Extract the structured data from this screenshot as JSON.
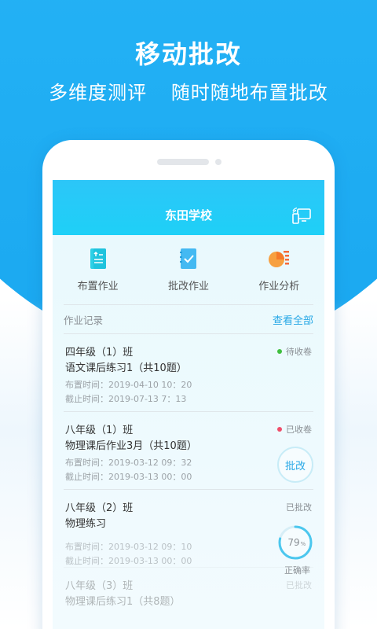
{
  "promo": {
    "title": "移动批改",
    "subtitle_left": "多维度测评",
    "subtitle_right": "随时随地布置批改"
  },
  "app": {
    "title": "东田学校",
    "actions": [
      {
        "label": "布置作业",
        "icon": "assign-homework-icon"
      },
      {
        "label": "批改作业",
        "icon": "grade-homework-icon"
      },
      {
        "label": "作业分析",
        "icon": "analysis-chart-icon"
      }
    ],
    "records_label": "作业记录",
    "view_all": "查看全部",
    "records": [
      {
        "class": "四年级（1）班",
        "task": "语文课后练习1（共10题）",
        "assigned": "布置时间：2019-04-10 10：20",
        "deadline": "截止时间：2019-07-13 7：13",
        "status": "待收卷"
      },
      {
        "class": "八年级（1）班",
        "task": "物理课后作业3月（共10题）",
        "assigned": "布置时间：2019-03-12 09：32",
        "deadline": "截止时间：2019-03-13 00：00",
        "status": "已收卷",
        "button": "批改"
      },
      {
        "class": "八年级（2）班",
        "task": "物理练习",
        "assigned": "布置时间：2019-03-12 09：10",
        "deadline": "截止时间：2019-03-13 00：00",
        "status": "已批改",
        "accuracy_value": "79",
        "accuracy_unit": "%",
        "accuracy_fraction": 0.79,
        "accuracy_label": "正确率"
      },
      {
        "class": "八年级（3）班",
        "task": "物理课后练习1（共8题）",
        "status": "已批改"
      }
    ]
  },
  "colors": {
    "brand_blue": "#22b0f4",
    "header_cyan": "#1ed0f7",
    "link_blue": "#27a8e6",
    "status_green": "#3fbf3f",
    "status_red": "#f04d6a"
  }
}
